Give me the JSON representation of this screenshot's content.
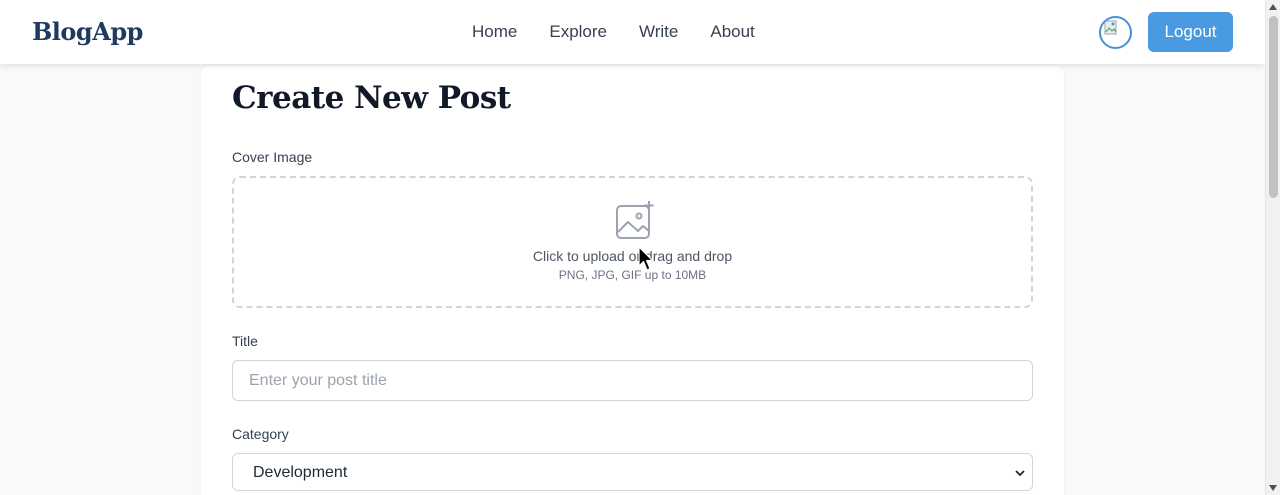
{
  "header": {
    "brand": "BlogApp",
    "nav": [
      {
        "label": "Home"
      },
      {
        "label": "Explore"
      },
      {
        "label": "Write"
      },
      {
        "label": "About"
      }
    ],
    "logout_label": "Logout"
  },
  "form": {
    "title": "Create New Post",
    "cover": {
      "label": "Cover Image",
      "upload_text": "Click to upload or drag and drop",
      "hint": "PNG, JPG, GIF up to 10MB"
    },
    "post_title": {
      "label": "Title",
      "placeholder": "Enter your post title",
      "value": ""
    },
    "category": {
      "label": "Category",
      "selected": "Development"
    }
  },
  "colors": {
    "brand": "#1e3a5f",
    "accent": "#4a9ae1",
    "border": "#d1d5db",
    "background": "#f8f9fa"
  },
  "icons": {
    "upload": "image-plus-icon",
    "select": "chevron-down-icon",
    "avatar": "broken-image-icon"
  }
}
